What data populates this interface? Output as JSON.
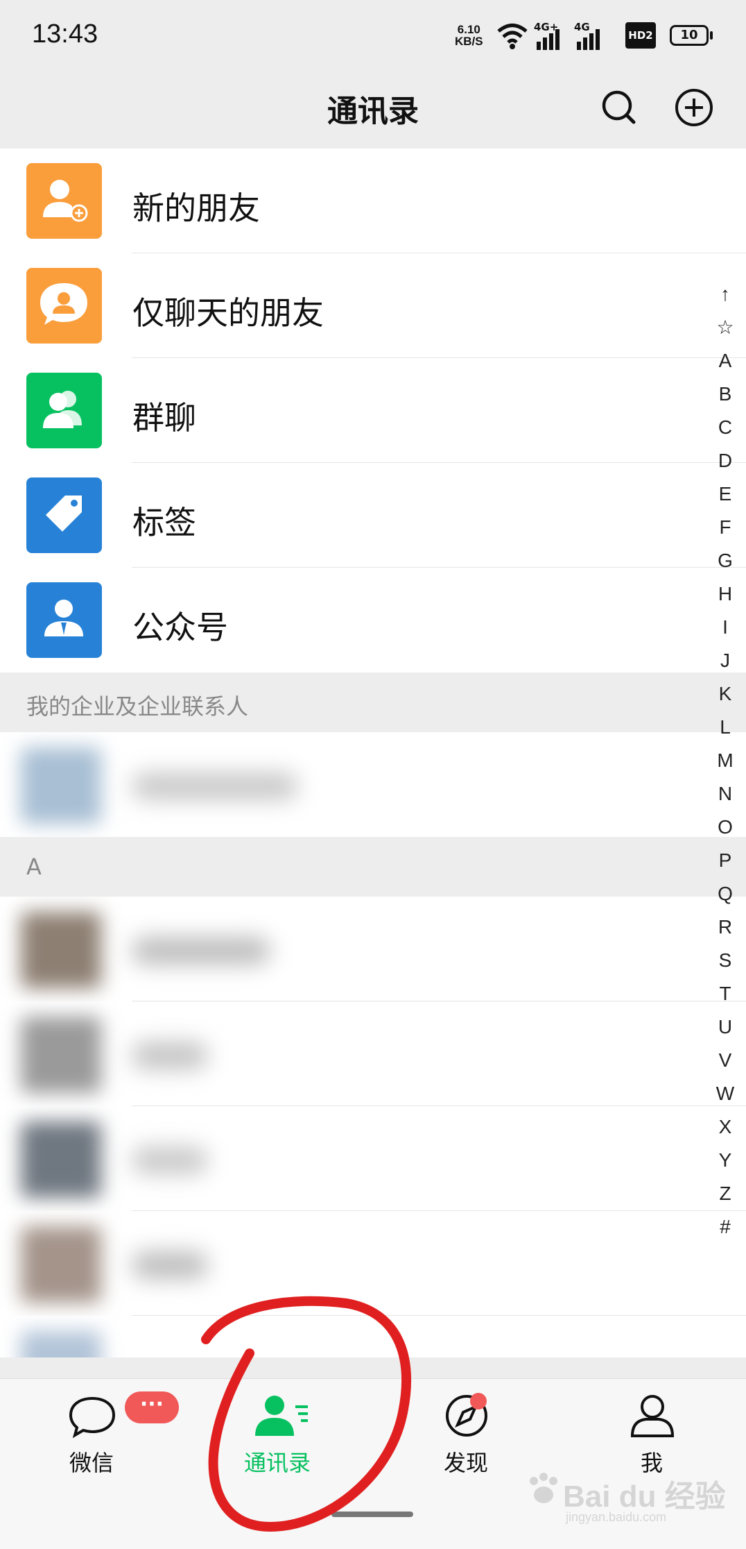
{
  "status_bar": {
    "time": "13:43",
    "net_speed_value": "6.10",
    "net_speed_unit": "KB/S",
    "signal1_label": "4G+",
    "signal2_label": "4G",
    "hd_label": "HD2",
    "battery": "10"
  },
  "header": {
    "title": "通讯录",
    "search_icon": "search-icon",
    "add_icon": "plus-circle-icon"
  },
  "menu": [
    {
      "label": "新的朋友",
      "icon": "add-friend-icon",
      "color": "#fa9d3b"
    },
    {
      "label": "仅聊天的朋友",
      "icon": "chat-only-friend-icon",
      "color": "#fa9d3b"
    },
    {
      "label": "群聊",
      "icon": "group-chat-icon",
      "color": "#07c160"
    },
    {
      "label": "标签",
      "icon": "tag-icon",
      "color": "#2782d7"
    },
    {
      "label": "公众号",
      "icon": "official-account-icon",
      "color": "#2782d7"
    }
  ],
  "sections": {
    "enterprise": "我的企业及企业联系人",
    "a": "A"
  },
  "index_letters": [
    "↑",
    "☆",
    "A",
    "B",
    "C",
    "D",
    "E",
    "F",
    "G",
    "H",
    "I",
    "J",
    "K",
    "L",
    "M",
    "N",
    "O",
    "P",
    "Q",
    "R",
    "S",
    "T",
    "U",
    "V",
    "W",
    "X",
    "Y",
    "Z",
    "#"
  ],
  "tabbar": {
    "tabs": [
      {
        "label": "微信",
        "icon": "chat-bubble-icon",
        "active": false
      },
      {
        "label": "通讯录",
        "icon": "contacts-icon",
        "active": true
      },
      {
        "label": "发现",
        "icon": "compass-icon",
        "active": false
      },
      {
        "label": "我",
        "icon": "person-icon",
        "active": false
      }
    ],
    "chat_badge": "···",
    "active_color": "#07c160"
  },
  "watermark": {
    "brand": "Bai du 经验",
    "url": "jingyan.baidu.com"
  }
}
